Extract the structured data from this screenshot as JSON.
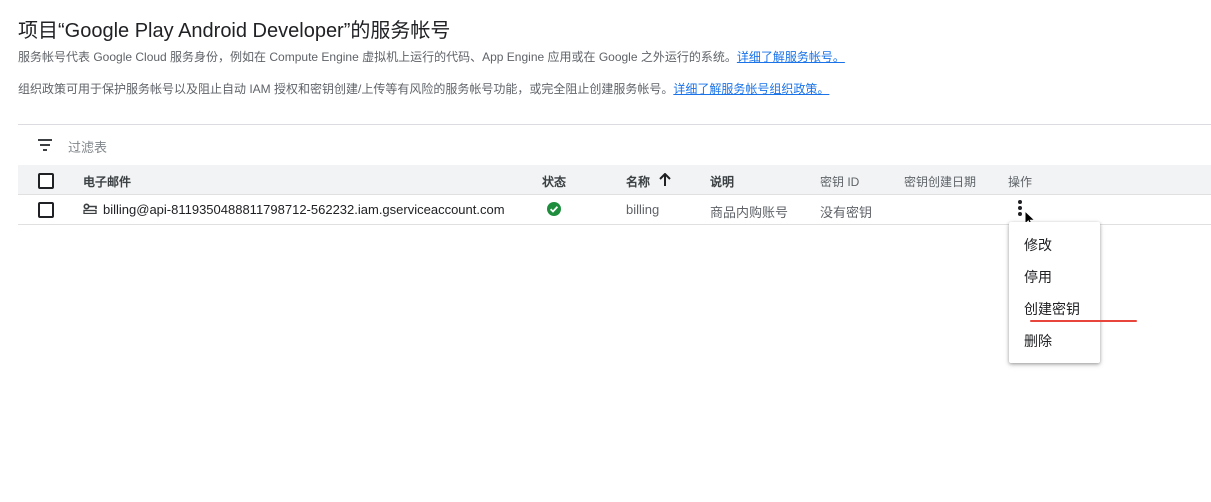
{
  "page": {
    "title": "项目“Google Play Android Developer”的服务帐号",
    "desc1_text": "服务帐号代表 Google Cloud 服务身份，例如在 Compute Engine 虚拟机上运行的代码、App Engine 应用或在 Google 之外运行的系统。",
    "desc1_link": "详细了解服务帐号。",
    "desc2_text": "组织政策可用于保护服务帐号以及阻止自动 IAM 授权和密钥创建/上传等有风险的服务帐号功能，或完全阻止创建服务帐号。",
    "desc2_link": "详细了解服务帐号组织政策。"
  },
  "filter": {
    "icon": "filter-icon",
    "label": "过滤表"
  },
  "table": {
    "columns": {
      "email": "电子邮件",
      "status": "状态",
      "name": "名称",
      "sort_icon": "arrow-upward-icon",
      "description": "说明",
      "key_id": "密钥 ID",
      "key_date": "密钥创建日期",
      "actions": "操作"
    },
    "rows": [
      {
        "email": "billing@api-8119350488811798712-562232.iam.gserviceaccount.com",
        "status_icon": "check-circle-icon",
        "name": "billing",
        "description": "商品内购账号",
        "key_id": "没有密钥",
        "key_date": ""
      }
    ]
  },
  "menu": {
    "items": [
      "修改",
      "停用",
      "创建密钥",
      "删除"
    ]
  },
  "colors": {
    "link": "#1a73e8",
    "status_ok": "#1e8e3e",
    "annotation": "#e8453c",
    "header_bg": "#f1f3f4"
  }
}
